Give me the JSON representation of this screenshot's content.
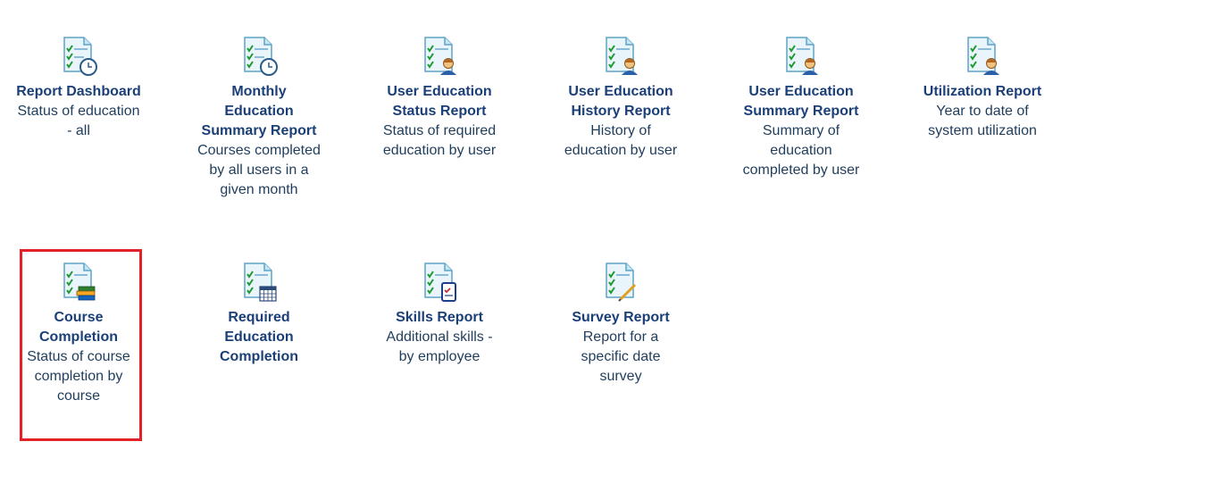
{
  "reports": [
    {
      "title": "Report Dashboard",
      "desc": "Status of education - all",
      "icon": "report-clock-icon"
    },
    {
      "title": "Monthly Education Summary Report",
      "desc": "Courses completed by all users in a given month",
      "icon": "report-clock-icon"
    },
    {
      "title": "User Education Status Report",
      "desc": "Status of required education by user",
      "icon": "report-user-icon"
    },
    {
      "title": "User Education History Report",
      "desc": "History of education by user",
      "icon": "report-user-icon"
    },
    {
      "title": "User Education Summary Report",
      "desc": "Summary of education completed by user",
      "icon": "report-user-icon"
    },
    {
      "title": "Utilization Report",
      "desc": "Year to date of system utilization",
      "icon": "report-user-icon"
    },
    {
      "title": "Course Completion",
      "desc": "Status of course completion by course",
      "icon": "report-books-icon",
      "selected": true
    },
    {
      "title": "Required Education Completion",
      "desc": "",
      "icon": "report-calendar-icon"
    },
    {
      "title": "Skills Report",
      "desc": "Additional skills - by employee",
      "icon": "report-checklist-icon"
    },
    {
      "title": "Survey Report",
      "desc": "Report for a specific date survey",
      "icon": "report-pen-icon"
    }
  ],
  "colors": {
    "title": "#1b3f78",
    "text": "#1f3d5d",
    "selection": "#e32227"
  }
}
